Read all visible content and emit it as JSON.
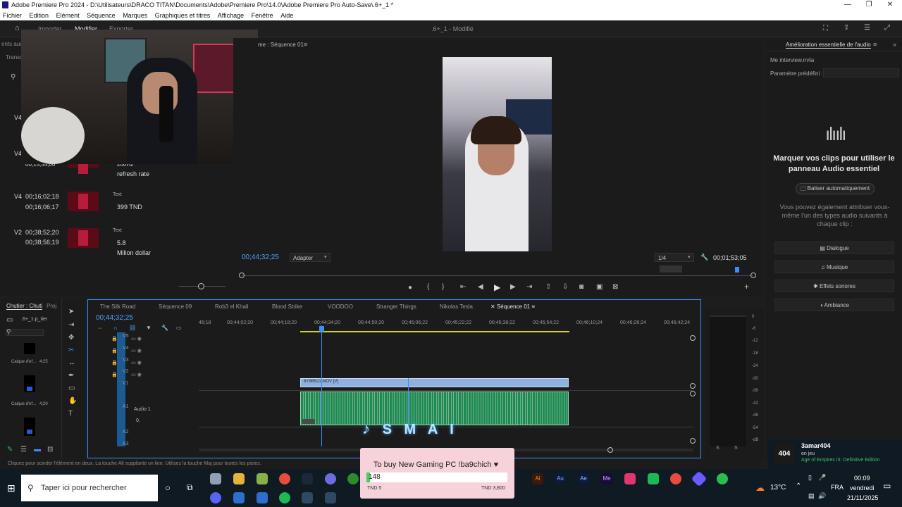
{
  "window": {
    "title": "Adobe Premiere Pro 2024 - D:\\Utilisateurs\\DRACO TITAN\\Documents\\Adobe\\Premiere Pro\\14.0\\Adobe Premiere Pro Auto-Save\\.6+_1 *",
    "minimize": "—",
    "maximize": "❐",
    "close": "✕"
  },
  "menu": [
    "Fichier",
    "Edition",
    "Elément",
    "Séquence",
    "Marques",
    "Graphiques et titres",
    "Affichage",
    "Fenêtre",
    "Aide"
  ],
  "header": {
    "tabs": [
      "Importer",
      "Modifier",
      "Exporter"
    ],
    "project_title": ".6+_1 - Modifié"
  },
  "left_panel": {
    "cut_label": "ents aud",
    "transcript_label": "Transc",
    "rows": [
      {
        "track": "V4",
        "t1": "",
        "t2": "",
        "type": "",
        "text": ""
      },
      {
        "track": "V4",
        "t1": "00;15;55;06",
        "t2": "",
        "type": "",
        "text": "refresh rate",
        "extra": "200Hz"
      },
      {
        "track": "V4",
        "t1": "00;16;02;18",
        "t2": "00;16;06;17",
        "type": "Text",
        "text": "399 TND"
      },
      {
        "track": "V2",
        "t1": "00;38;52;20",
        "t2": "00;38;56;19",
        "type": "Text",
        "text": "5.8",
        "text2": "Milion dollar"
      }
    ]
  },
  "program_monitor": {
    "label": "me : Séquence 01",
    "timecode": "00;44;32;25",
    "fit": "Adapter",
    "resolution": "1/4",
    "duration": "00;01;53;05"
  },
  "essential_sound": {
    "title": "Amélioration essentielle de l'audio",
    "clip_name": "Me interview.m4a",
    "preset_label": "Paramètre prédéfini :",
    "heading": "Marquer vos clips pour utiliser le panneau Audio essentiel",
    "auto_button": "Baliser automatiquement",
    "description": "Vous pouvez également attribuer vous-même l'un des types audio suivants à chaque clip :",
    "types": [
      "Dialogue",
      "Musique",
      "Effets sonores",
      "Ambiance"
    ]
  },
  "project_bin": {
    "title": "Chutier : Chuti",
    "subtitle": "Proj",
    "item": ".6+_1.p_tier",
    "clip1": "Calque d'ef...",
    "clip1_dur": "4;25",
    "clip2": "Calque d'ef...",
    "clip2_dur": "4;20"
  },
  "timeline": {
    "tabs": [
      "The Silk Road",
      "Séquence 09",
      "Rob3 el Khali",
      "Blood Strike",
      "VOODOO",
      "Stranger Things",
      "Nikolas Tesla",
      "Séquence 01"
    ],
    "timecode": "00;44;32;25",
    "ruler": [
      "46;18",
      "00;44;02;20",
      "00;44;18;20",
      "00;44;34;20",
      "00;44;50;20",
      "00;45;06;22",
      "00;45;22;22",
      "00;45;38;22",
      "00;45;54;22",
      "00;46;10;24",
      "00;46;26;24",
      "00;46;42;24"
    ],
    "tracks": [
      "V5",
      "V4",
      "V3",
      "V2",
      "V1",
      "A1",
      "A2",
      "A3"
    ],
    "audio_track_name": "Audio 1",
    "audio_value": "0,",
    "video_clip": "8Y9B521.MOV [V]",
    "meter_scale": [
      "0",
      "-6",
      "-12",
      "-18",
      "-24",
      "-30",
      "-36",
      "-42",
      "-48",
      "-54",
      "-dB"
    ],
    "meter_bottom": [
      "S",
      "S"
    ]
  },
  "status_bar": "Cliquez pour scinder l'élément en deux. La touche Alt supplante un lien. Utilisez la touche Maj pour toutes les pistes.",
  "overlay": {
    "tiktok_brand": "S M A I",
    "donation_text": "To buy New Gaming PC !ba9chich ♥",
    "donation_value": "148",
    "donation_min": "TND 5",
    "donation_max": "TND 3,800"
  },
  "stream": {
    "channel": "3amar404",
    "status": "en jeu",
    "game": "Age of Empires III: Definitive Edition",
    "badge": "404"
  },
  "taskbar": {
    "search_placeholder": "Taper ici pour rechercher",
    "temperature": "13°C",
    "language": "FRA",
    "time": "00:09",
    "day": "vendredi",
    "date": "21/11/2025"
  }
}
